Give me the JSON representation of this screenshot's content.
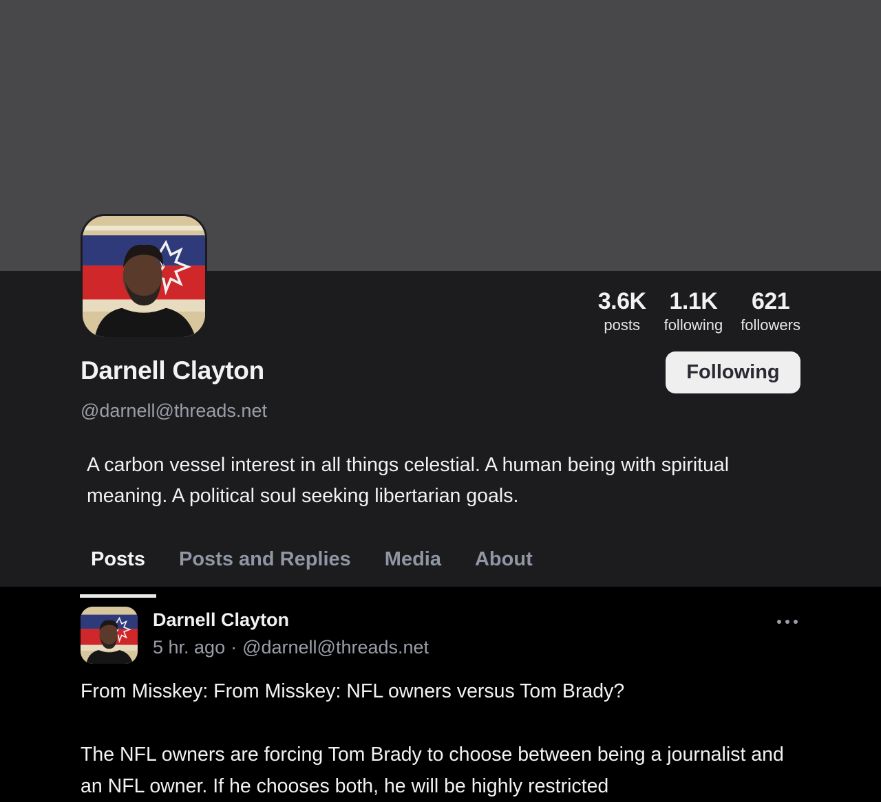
{
  "profile": {
    "display_name": "Darnell Clayton",
    "handle": "@darnell@threads.net",
    "bio": "A carbon vessel interest in all things celestial. A human being with spiritual meaning. A political soul seeking libertarian goals.",
    "avatar_icon": "profile-photo",
    "stats": [
      {
        "value": "3.6K",
        "label": "posts"
      },
      {
        "value": "1.1K",
        "label": "following"
      },
      {
        "value": "621",
        "label": "followers"
      }
    ],
    "follow_button_label": "Following"
  },
  "tabs": [
    {
      "label": "Posts",
      "active": true
    },
    {
      "label": "Posts and Replies",
      "active": false
    },
    {
      "label": "Media",
      "active": false
    },
    {
      "label": "About",
      "active": false
    }
  ],
  "posts": [
    {
      "author": "Darnell Clayton",
      "time": "5 hr. ago",
      "separator": "·",
      "handle": "@darnell@threads.net",
      "more_icon": "ellipsis-horizontal",
      "paragraphs": [
        "From Misskey: From Misskey: NFL owners versus Tom Brady?",
        "The NFL owners are forcing Tom Brady to choose between being a journalist and an NFL owner. If he chooses both, he will be highly restricted"
      ]
    }
  ],
  "colors": {
    "banner": "#48484a",
    "profile_bg": "#1c1c1e",
    "feed_bg": "#000000",
    "muted_text": "#9b9ea8",
    "button_bg": "#efeff0"
  }
}
